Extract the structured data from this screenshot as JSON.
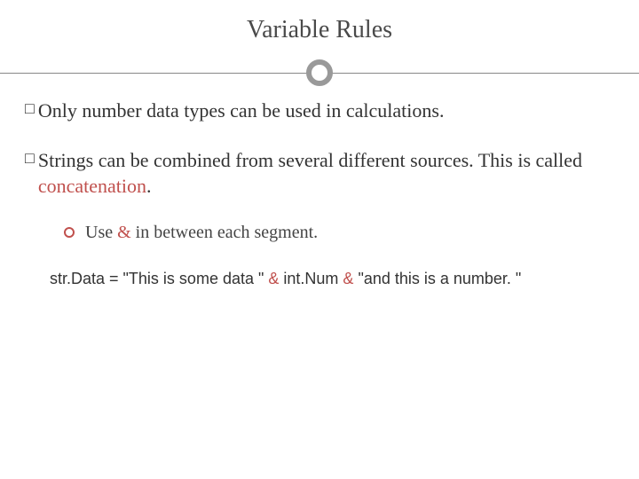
{
  "title": "Variable Rules",
  "bullets": [
    {
      "text": "Only number data types can be used in calculations."
    },
    {
      "prefix": "Strings can be combined from several different sources. This is called ",
      "highlight": "concatenation",
      "suffix": "."
    }
  ],
  "sub_bullet": {
    "prefix": "Use ",
    "highlight": "&",
    "suffix": " in between each segment."
  },
  "code": {
    "part1": "str.Data = \"This is some data \" ",
    "amp1": "&",
    "part2": " int.Num ",
    "amp2": "&",
    "part3": " \"and this is a number. \""
  }
}
